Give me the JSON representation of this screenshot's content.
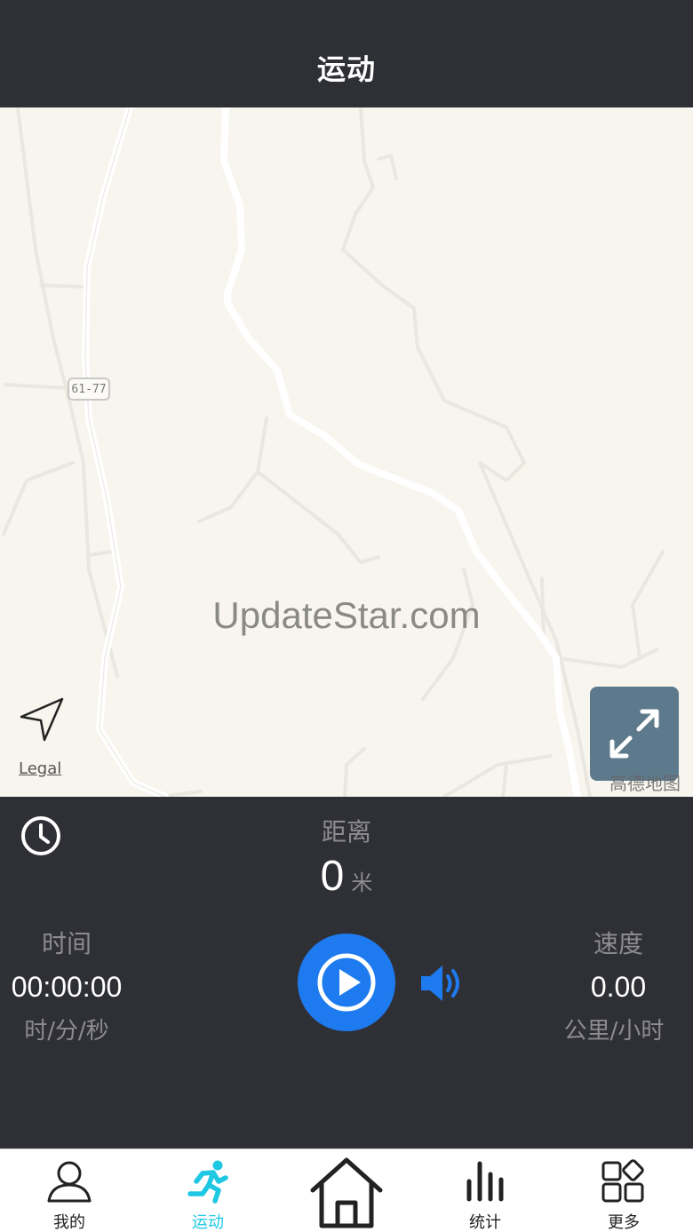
{
  "header": {
    "title": "运动"
  },
  "map": {
    "road_label": "61-77",
    "watermark": "UpdateStar.com",
    "legal_link": "Legal",
    "provider_logo": "高德地图",
    "locate_icon": "navigation-arrow-icon",
    "expand_icon": "expand-arrows-icon"
  },
  "stats": {
    "clock_icon": "clock-icon",
    "distance": {
      "label": "距离",
      "value": "0",
      "unit": "米"
    },
    "time": {
      "label": "时间",
      "value": "00:00:00",
      "unit": "时/分/秒"
    },
    "speed": {
      "label": "速度",
      "value": "0.00",
      "unit": "公里/小时"
    },
    "play_icon": "play-icon",
    "volume_icon": "volume-icon"
  },
  "colors": {
    "dark_bg": "#2f3036",
    "accent_blue": "#1e7aef",
    "active_tab": "#1ec8e3",
    "map_bg": "#f7f5ee"
  },
  "tabbar": {
    "items": [
      {
        "label": "我的",
        "icon": "user-icon"
      },
      {
        "label": "运动",
        "icon": "running-icon",
        "active": true
      },
      {
        "label": "",
        "icon": "home-icon"
      },
      {
        "label": "统计",
        "icon": "bar-chart-icon"
      },
      {
        "label": "更多",
        "icon": "grid-more-icon"
      }
    ]
  }
}
